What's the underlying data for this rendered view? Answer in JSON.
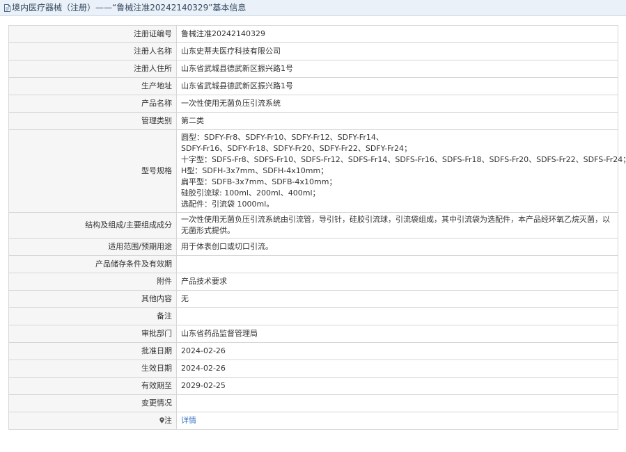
{
  "header": {
    "title": "境内医疗器械（注册）——“鲁械注准20242140329”基本信息"
  },
  "rows": [
    {
      "label": "注册证编号",
      "value": "鲁械注准20242140329"
    },
    {
      "label": "注册人名称",
      "value": "山东史蒂夫医疗科技有限公司"
    },
    {
      "label": "注册人住所",
      "value": "山东省武城县德武新区振兴路1号"
    },
    {
      "label": "生产地址",
      "value": "山东省武城县德武新区振兴路1号"
    },
    {
      "label": "产品名称",
      "value": "一次性使用无菌负压引流系统"
    },
    {
      "label": "管理类别",
      "value": "第二类"
    },
    {
      "label": "型号规格",
      "lines": [
        "圆型：SDFY-Fr8、SDFY-Fr10、SDFY-Fr12、SDFY-Fr14、",
        "SDFY-Fr16、SDFY-Fr18、SDFY-Fr20、SDFY-Fr22、SDFY-Fr24；",
        "十字型：SDFS-Fr8、SDFS-Fr10、SDFS-Fr12、SDFS-Fr14、SDFS-Fr16、SDFS-Fr18、SDFS-Fr20、SDFS-Fr22、SDFS-Fr24；",
        "H型：SDFH-3x7mm、SDFH-4x10mm；",
        "扁平型：SDFB-3x7mm、SDFB-4x10mm；",
        "硅胶引流球: 100ml、200ml、400ml；",
        "选配件：引流袋 1000ml。"
      ]
    },
    {
      "label": "结构及组成/主要组成成分",
      "value": "一次性使用无菌负压引流系统由引流管，导引针，硅胶引流球，引流袋组成，其中引流袋为选配件，本产品经环氧乙烷灭菌，以无菌形式提供。"
    },
    {
      "label": "适用范围/预期用途",
      "value": "用于体表创口或切口引流。"
    },
    {
      "label": "产品储存条件及有效期",
      "value": ""
    },
    {
      "label": "附件",
      "value": "产品技术要求"
    },
    {
      "label": "其他内容",
      "value": "无"
    },
    {
      "label": "备注",
      "value": ""
    },
    {
      "label": "审批部门",
      "value": "山东省药品监督管理局"
    },
    {
      "label": "批准日期",
      "value": "2024-02-26"
    },
    {
      "label": "生效日期",
      "value": "2024-02-26"
    },
    {
      "label": "有效期至",
      "value": "2029-02-25"
    },
    {
      "label": "变更情况",
      "value": ""
    },
    {
      "label": "注",
      "value": "详情",
      "icon": "map-pin-icon"
    }
  ]
}
